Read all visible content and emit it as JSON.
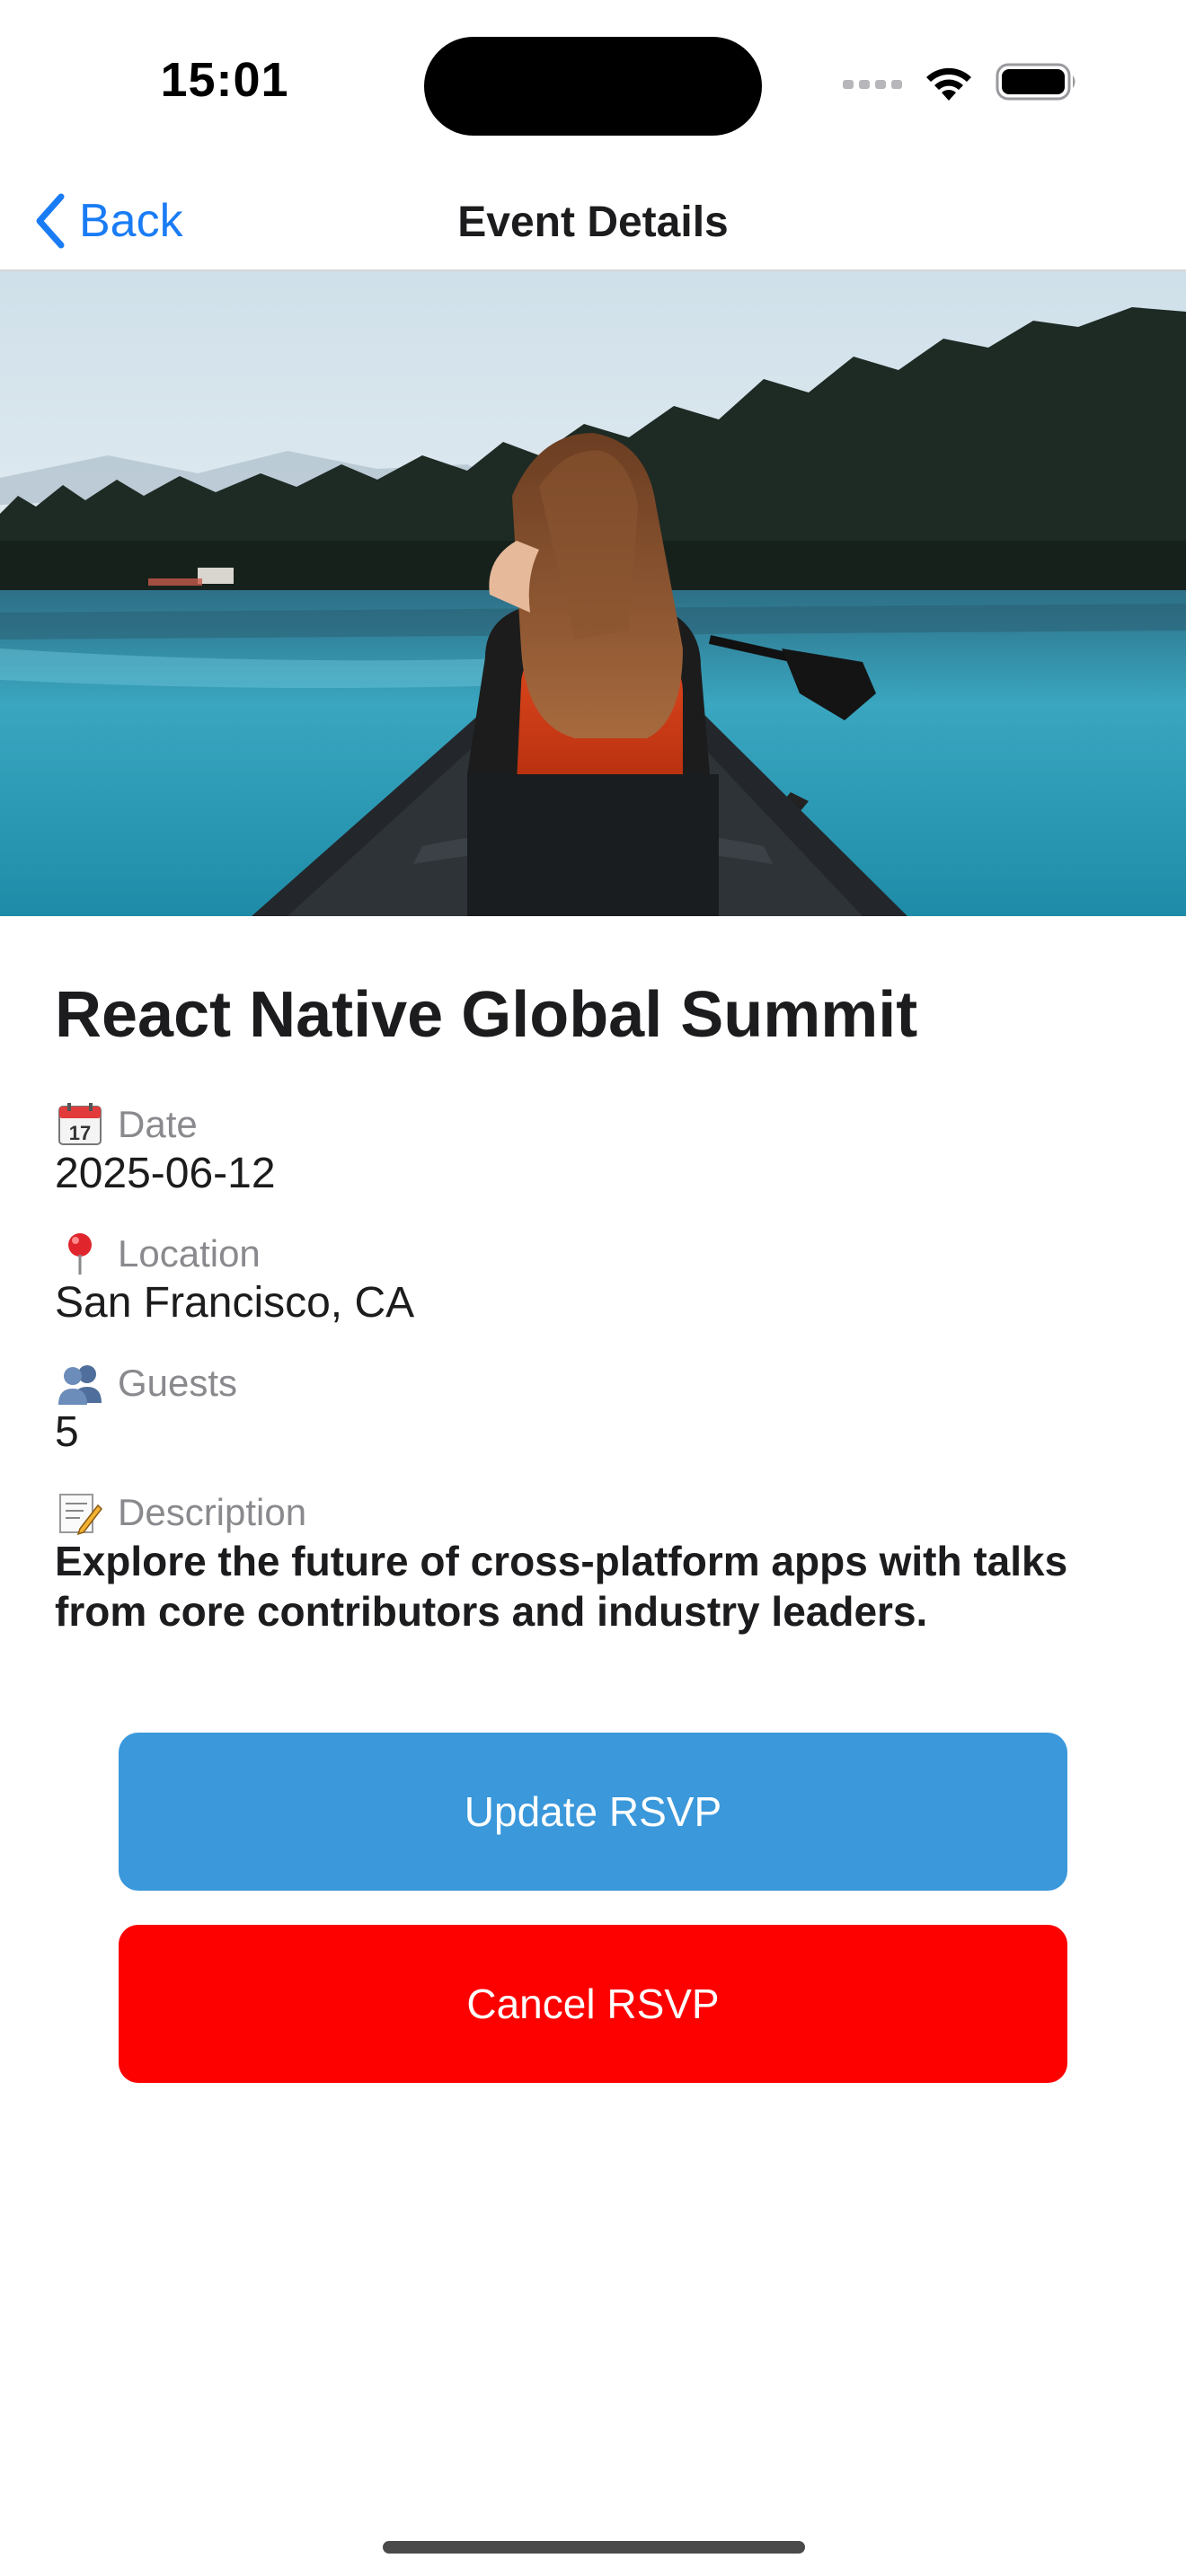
{
  "status_bar": {
    "time": "15:01"
  },
  "nav": {
    "back_label": "Back",
    "title": "Event Details"
  },
  "hero": {
    "description_icon": "photo"
  },
  "event": {
    "title": "React Native Global Summit",
    "fields": [
      {
        "icon": "calendar-icon",
        "label": "Date",
        "value": "2025-06-12"
      },
      {
        "icon": "pin-icon",
        "label": "Location",
        "value": "San Francisco, CA"
      },
      {
        "icon": "guests-icon",
        "label": "Guests",
        "value": "5"
      },
      {
        "icon": "memo-icon",
        "label": "Description",
        "value": "Explore the future of cross-platform apps with talks from core contributors and industry leaders."
      }
    ]
  },
  "actions": {
    "update_label": "Update RSVP",
    "cancel_label": "Cancel RSVP"
  },
  "colors": {
    "accent": "#1a7cf5",
    "update_button": "#3a98db",
    "cancel_button": "#fd0000"
  }
}
